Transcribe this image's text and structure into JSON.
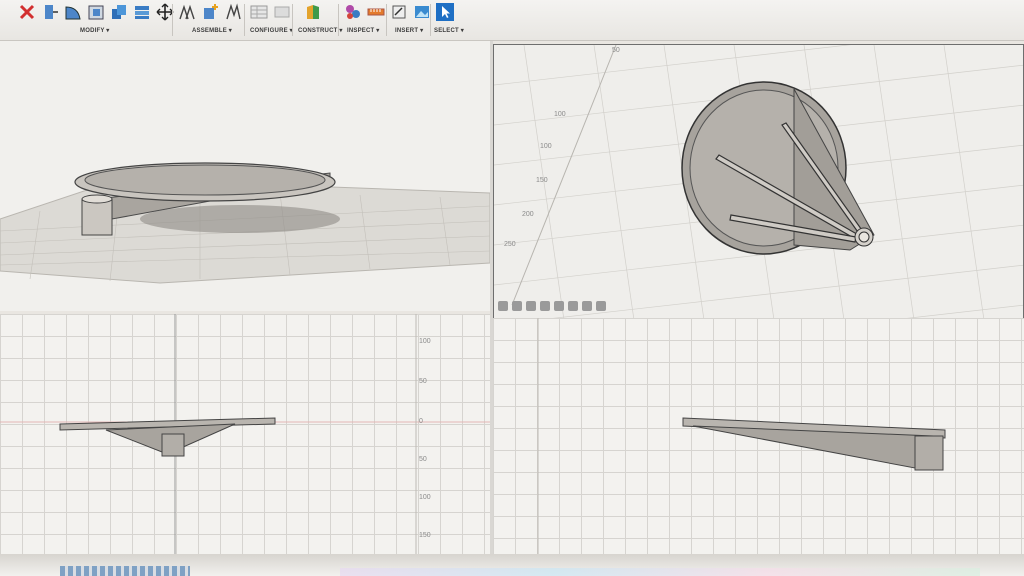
{
  "toolbar": {
    "groups": [
      {
        "label": "MODIFY ▾"
      },
      {
        "label": "ASSEMBLE ▾"
      },
      {
        "label": "CONFIGURE ▾"
      },
      {
        "label": "CONSTRUCT ▾"
      },
      {
        "label": "INSPECT ▾"
      },
      {
        "label": "INSERT ▾"
      },
      {
        "label": "SELECT ▾"
      }
    ]
  },
  "viewports": {
    "top_right_ruler": [
      "50",
      "100",
      "150",
      "200",
      "250"
    ],
    "bottom_left_ruler": [
      "100",
      "50",
      "0",
      "50",
      "100",
      "150"
    ]
  },
  "colors": {
    "accent_select": "#1f6fc4",
    "delete_red": "#d22f2f",
    "model_fill": "#b8b4ae",
    "model_stroke": "#4a4a4a"
  }
}
